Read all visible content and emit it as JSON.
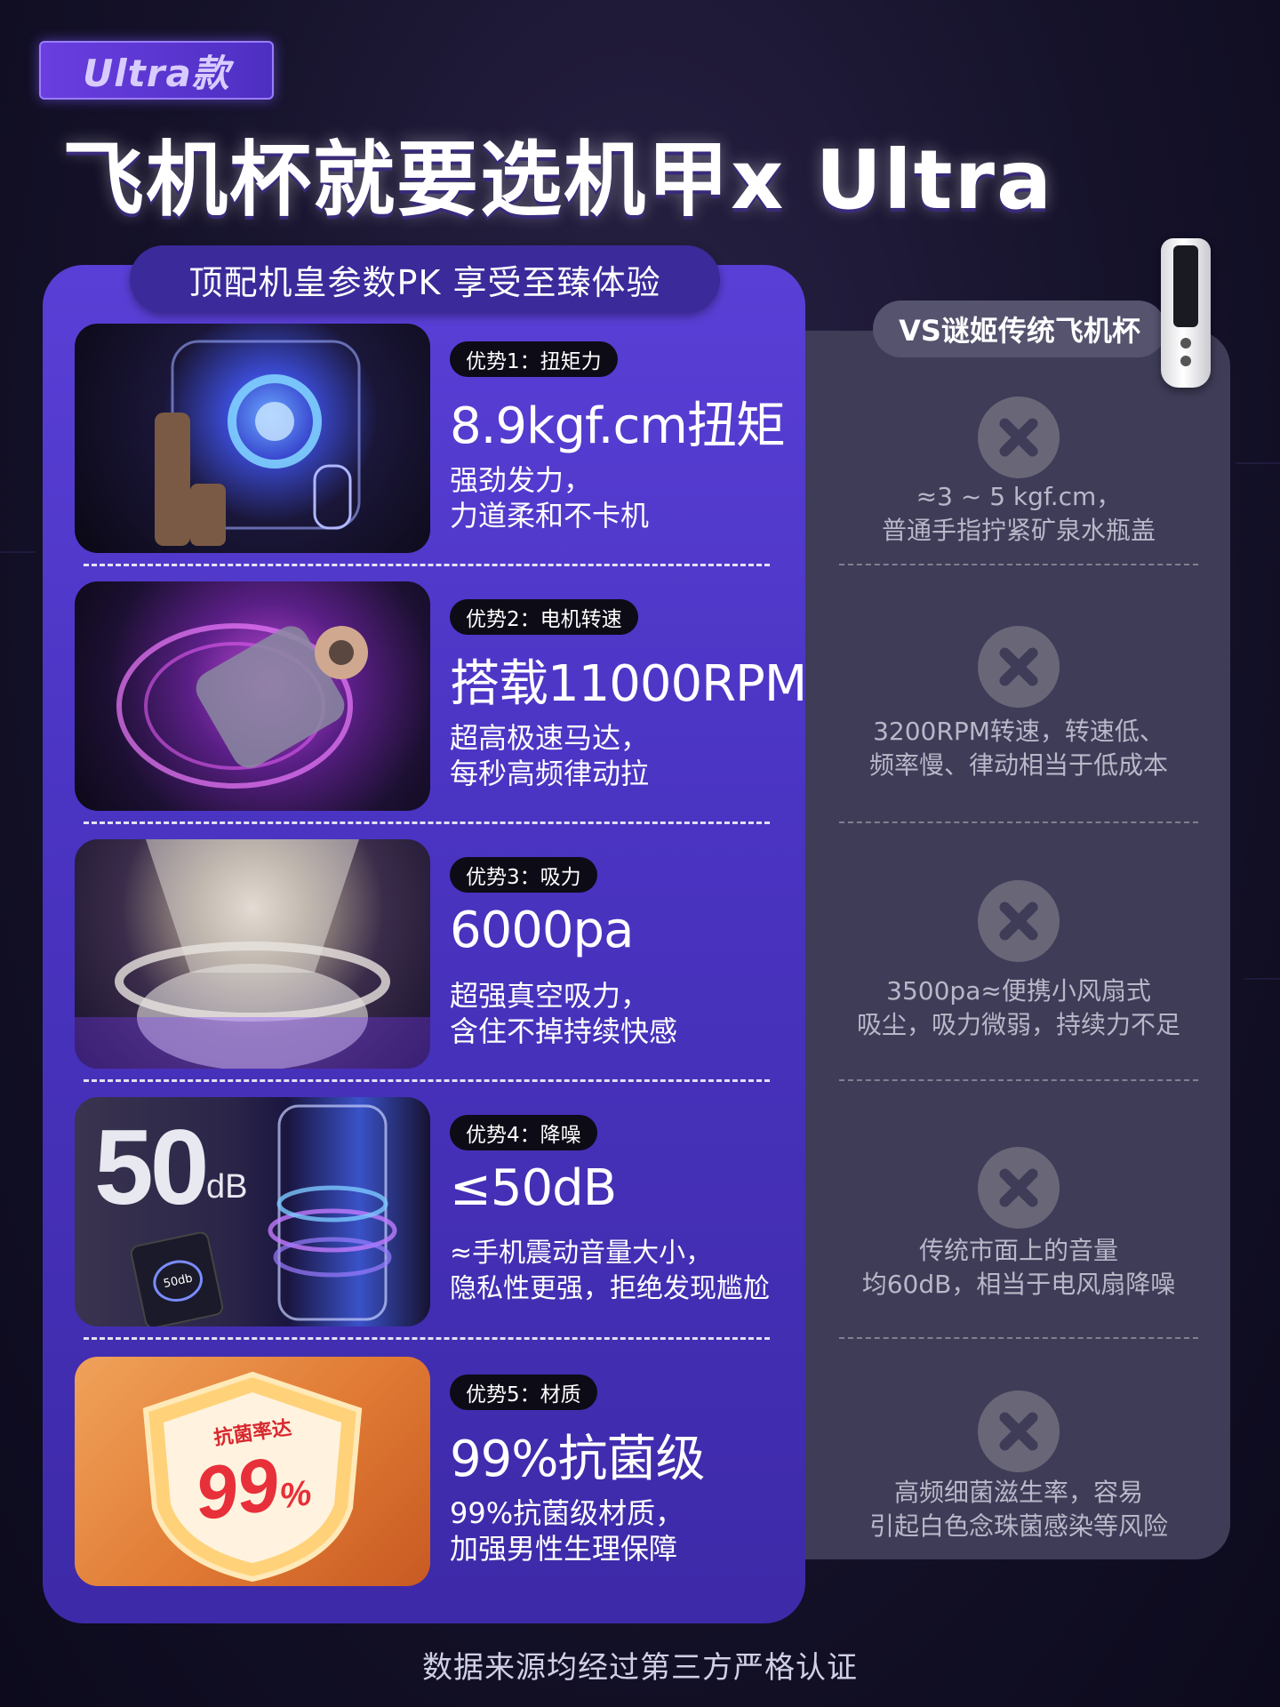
{
  "header": {
    "badge": "Ultra款",
    "title": "飞机杯就要选机甲x Ultra",
    "subtitle": "顶配机皇参数PK   享受至臻体验",
    "vs_label": "VS谜姬传统飞机杯"
  },
  "rows": [
    {
      "tag": "优势1：扭矩力",
      "headline": "8.9kgf.cm扭矩",
      "desc_line1": "强劲发力，",
      "desc_line2": "力道柔和不卡机",
      "compare_line1": "≈3 ~ 5 kgf.cm，",
      "compare_line2": "普通手指拧紧矿泉水瓶盖",
      "thumb_icon": "robot-arm-device-image"
    },
    {
      "tag": "优势2：电机转速",
      "headline": "搭载11000RPM",
      "desc_line1": "超高极速马达，",
      "desc_line2": "每秒高频律动拉",
      "compare_line1": "3200RPM转速，转速低、",
      "compare_line2": "频率慢、律动相当于低成本",
      "thumb_icon": "motor-image"
    },
    {
      "tag": "优势3：吸力",
      "headline": "6000pa",
      "desc_line1": "超强真空吸力，",
      "desc_line2": "含住不掉持续快感",
      "compare_line1": "3500pa≈便携小风扇式",
      "compare_line2": "吸尘，吸力微弱，持续力不足",
      "thumb_icon": "suction-cup-image"
    },
    {
      "tag": "优势4：降噪",
      "headline": "≤50dB",
      "desc_line1": "≈手机震动音量大小，",
      "desc_line2": "隐私性更强，拒绝发现尴尬",
      "compare_line1": "传统市面上的音量",
      "compare_line2": "均60dB，相当于电风扇降噪",
      "thumb_icon": "noise-meter-image",
      "thumb_big": "50",
      "thumb_unit": "dB",
      "thumb_phone": "50db"
    },
    {
      "tag": "优势5：材质",
      "headline": "99%抗菌级",
      "desc_line1": "99%抗菌级材质，",
      "desc_line2": "加强男性生理保障",
      "compare_line1": "高频细菌滋生率，容易",
      "compare_line2": "引起白色念珠菌感染等风险",
      "thumb_icon": "shield-image",
      "shield_label": "抗菌率达",
      "shield_value": "99",
      "shield_unit": "%"
    }
  ],
  "footer": "数据来源均经过第三方严格认证",
  "colors": {
    "panel_purple": "#4a34c2",
    "panel_grey": "#3e3c57",
    "x_mark": "#696678"
  }
}
